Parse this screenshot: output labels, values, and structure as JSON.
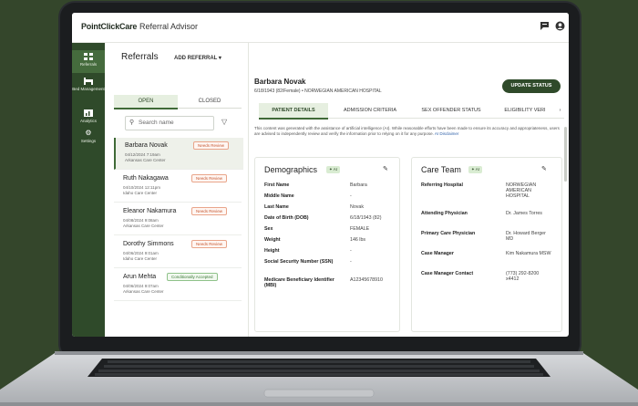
{
  "header": {
    "brand": "PointClickCare",
    "app_name": "Referral Advisor",
    "icons": [
      "message-icon",
      "user-icon"
    ]
  },
  "nav": [
    {
      "label": "Referrals",
      "icon": "grid-icon",
      "active": true
    },
    {
      "label": "Bed Management",
      "icon": "bed-icon",
      "active": false
    },
    {
      "label": "Analytics",
      "icon": "chart-icon",
      "active": false
    },
    {
      "label": "Settings",
      "icon": "gear-icon",
      "active": false
    }
  ],
  "referrals": {
    "title": "Referrals",
    "add_label": "ADD REFERRAL",
    "tabs": [
      "OPEN",
      "CLOSED"
    ],
    "search_placeholder": "Search name",
    "items": [
      {
        "name": "Barbara Novak",
        "date": "04/12/2024 7:19am",
        "facility": "Arkansas Care Center",
        "status": "Needs Review"
      },
      {
        "name": "Ruth Nakagawa",
        "date": "04/10/2024 12:11pm",
        "facility": "Idaho Care Center",
        "status": "Needs Review"
      },
      {
        "name": "Eleanor Nakamura",
        "date": "04/08/2024 9:08am",
        "facility": "Arkansas Care Center",
        "status": "Needs Review"
      },
      {
        "name": "Dorothy Simmons",
        "date": "04/06/2024 9:01am",
        "facility": "Idaho Care Center",
        "status": "Needs Review"
      },
      {
        "name": "Arun Mehta",
        "date": "04/06/2024 9:07am",
        "facility": "Arkansas Care Center",
        "status": "Conditionally Accepted"
      }
    ]
  },
  "patient": {
    "name": "Barbara Novak",
    "subtitle": "6/18/1943 (82/Female) • NORWEGIAN AMERICAN HOSPITAL",
    "update_label": "UPDATE STATUS",
    "tabs": [
      "PATIENT DETAILS",
      "ADMISSION CRITERIA",
      "SEX OFFENDER STATUS",
      "ELIGIBILITY VERI"
    ],
    "ai_note": "This content was generated with the assistance of artificial intelligence (AI). While reasonable efforts have been made to ensure its accuracy and appropriateness, users are advised to independently review and verify the information prior to relying on it for any purpose.",
    "ai_link": "AI Disclaimer"
  },
  "demographics": {
    "title": "Demographics",
    "chip": "AI",
    "rows": [
      {
        "label": "First Name",
        "value": "Barbara"
      },
      {
        "label": "Middle Name",
        "value": "-"
      },
      {
        "label": "Last Name",
        "value": "Novak"
      },
      {
        "label": "Date of Birth (DOB)",
        "value": "6/18/1943 (82)"
      },
      {
        "label": "Sex",
        "value": "FEMALE"
      },
      {
        "label": "Weight",
        "value": "146 lbs"
      },
      {
        "label": "Height",
        "value": "-"
      },
      {
        "label": "Social Security Number (SSN)",
        "value": "-"
      },
      {
        "label": "Medicare Beneficiary Identifier (MBI)",
        "value": "A12345678910"
      }
    ]
  },
  "care_team": {
    "title": "Care Team",
    "chip": "AI",
    "rows": [
      {
        "label": "Referring Hospital",
        "value": "NORWEGIAN AMERICAN HOSPITAL"
      },
      {
        "label": "Attending Physician",
        "value": "Dr. James Torres"
      },
      {
        "label": "Primary Care Physician",
        "value": "Dr. Howard Berger MD"
      },
      {
        "label": "Case Manager",
        "value": "Kim Nakamura MSW"
      },
      {
        "label": "Case Manager Contact",
        "value": "(773) 292-8200 x4412"
      }
    ]
  }
}
